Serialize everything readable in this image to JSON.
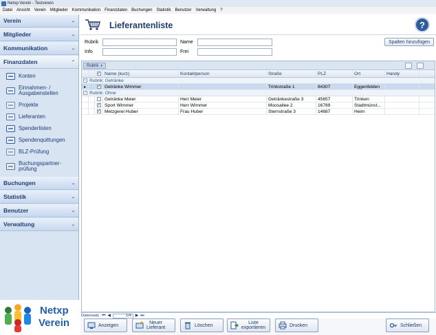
{
  "window": {
    "title": "Netxp:Verein - Testverein"
  },
  "menu": [
    "Datei",
    "Ansicht",
    "Verein",
    "Mitglieder",
    "Kommunikation",
    "Finanzdaten",
    "Buchungen",
    "Statistik",
    "Benutzer",
    "Verwaltung",
    "?"
  ],
  "sidebar": {
    "sections_top": [
      "Verein",
      "Mitglieder",
      "Kommunikation"
    ],
    "active_section": "Finanzdaten",
    "items": [
      "Konten",
      "Einnahmen- / Ausgabenstellen",
      "Projekte",
      "Lieferanten",
      "Spenderlisten",
      "Spendenquittungen",
      "BLZ-Prüfung",
      "Buchungspartner-prüfung"
    ],
    "items_lines": [
      [
        "Konten"
      ],
      [
        "Einnahmen- /",
        "Ausgabenstellen"
      ],
      [
        "Projekte"
      ],
      [
        "Lieferanten"
      ],
      [
        "Spenderlisten"
      ],
      [
        "Spendenquittungen"
      ],
      [
        "BLZ-Prüfung"
      ],
      [
        "Buchungspartner-",
        "prüfung"
      ]
    ],
    "sections_bottom": [
      "Buchungen",
      "Statistik",
      "Benutzer",
      "Verwaltung"
    ]
  },
  "logo": {
    "line1": "Netxp",
    "line2": "Verein"
  },
  "page": {
    "title": "Lieferantenliste",
    "help": "?"
  },
  "filters": {
    "rubrik_label": "Rubrik",
    "rubrik_value": "",
    "name_label": "Name",
    "name_value": "",
    "info_label": "Info",
    "info_value": "",
    "frei_label": "Frei",
    "frei_value": "",
    "add_columns": "Spalten hinzufügen"
  },
  "grid": {
    "group_chip": "Rubrik",
    "columns": [
      "Name (kurz)",
      "Kontaktperson",
      "Straße",
      "PLZ",
      "Ort",
      "Handy"
    ],
    "groups": [
      {
        "label": "Rubrik: Getränke",
        "rows": [
          {
            "checked": true,
            "selected": true,
            "name": "Getränke Wimmer",
            "kontakt": "",
            "strasse": "Trinkstraße 1",
            "plz": "84307",
            "ort": "Eggenfelden",
            "handy": ""
          }
        ]
      },
      {
        "label": "Rubrik: Ohne",
        "rows": [
          {
            "checked": false,
            "selected": false,
            "name": "Getränke Meier",
            "kontakt": "Herr Meier",
            "strasse": "Getränkestraße 3",
            "plz": "45657",
            "ort": "Trinken",
            "handy": ""
          },
          {
            "checked": true,
            "selected": false,
            "name": "Sport Wimmer",
            "kontakt": "Herr Wimmer",
            "strasse": "Moosallee 2",
            "plz": "16789",
            "ort": "Stadtmünst...",
            "handy": ""
          },
          {
            "checked": true,
            "selected": false,
            "name": "Metzgerei Huber",
            "kontakt": "Frau Huber",
            "strasse": "Sternstraße 3",
            "plz": "14687",
            "ort": "Heim",
            "handy": ""
          }
        ]
      }
    ]
  },
  "navigator": {
    "label": "Datensatz",
    "first": "⏮",
    "prev": "◀",
    "position": "1/4",
    "next": "▶",
    "last": "⏭"
  },
  "footer": {
    "anzeigen": "Anzeigen",
    "neu_line1": "Neuer",
    "neu_line2": "Lieferant",
    "loeschen": "Löschen",
    "export_line1": "Liste",
    "export_line2": "exportieren",
    "drucken": "Drucken",
    "schliessen": "Schließen"
  },
  "colors": {
    "accent": "#1f3d6e",
    "sidebar_bg": "#d9e4f2",
    "selected_row": "#c9d9ee"
  }
}
